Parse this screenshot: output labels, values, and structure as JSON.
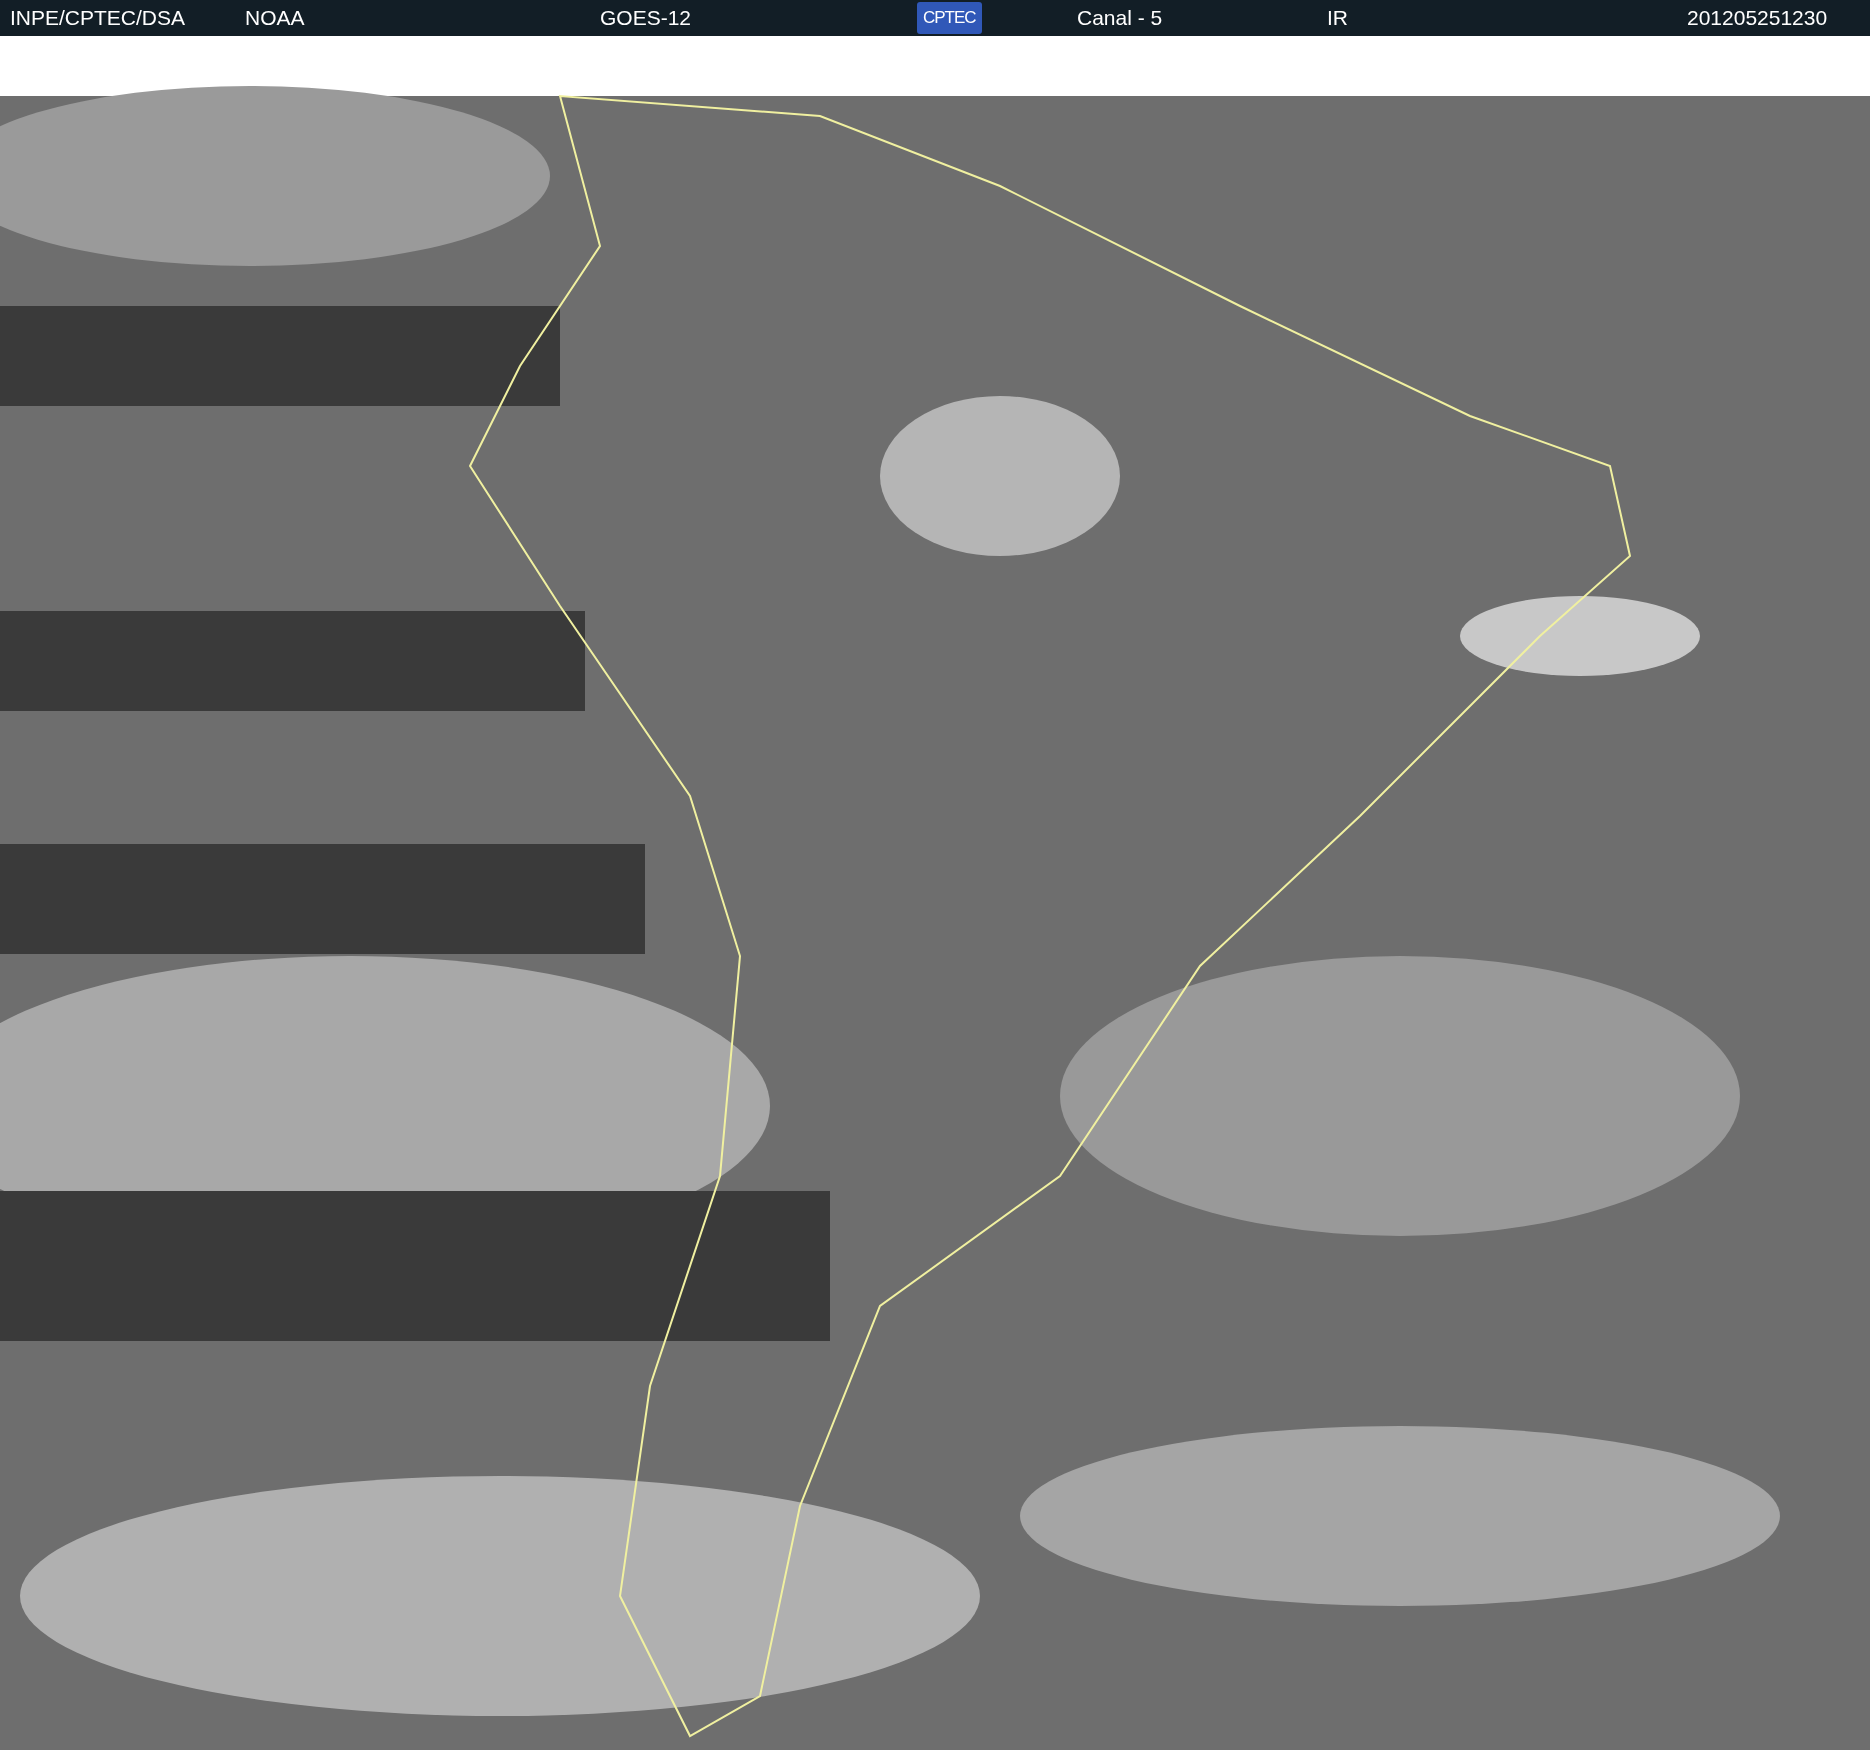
{
  "header": {
    "items": [
      {
        "kind": "text",
        "text": "INPE/CPTEC/DSA"
      },
      {
        "kind": "text",
        "text": "NOAA"
      },
      {
        "kind": "text",
        "text": "GOES-12"
      },
      {
        "kind": "logo",
        "text": "CPTEC"
      },
      {
        "kind": "text",
        "text": "Canal - 5"
      },
      {
        "kind": "text",
        "text": "IR"
      },
      {
        "kind": "text",
        "text": "201205251230"
      }
    ]
  }
}
